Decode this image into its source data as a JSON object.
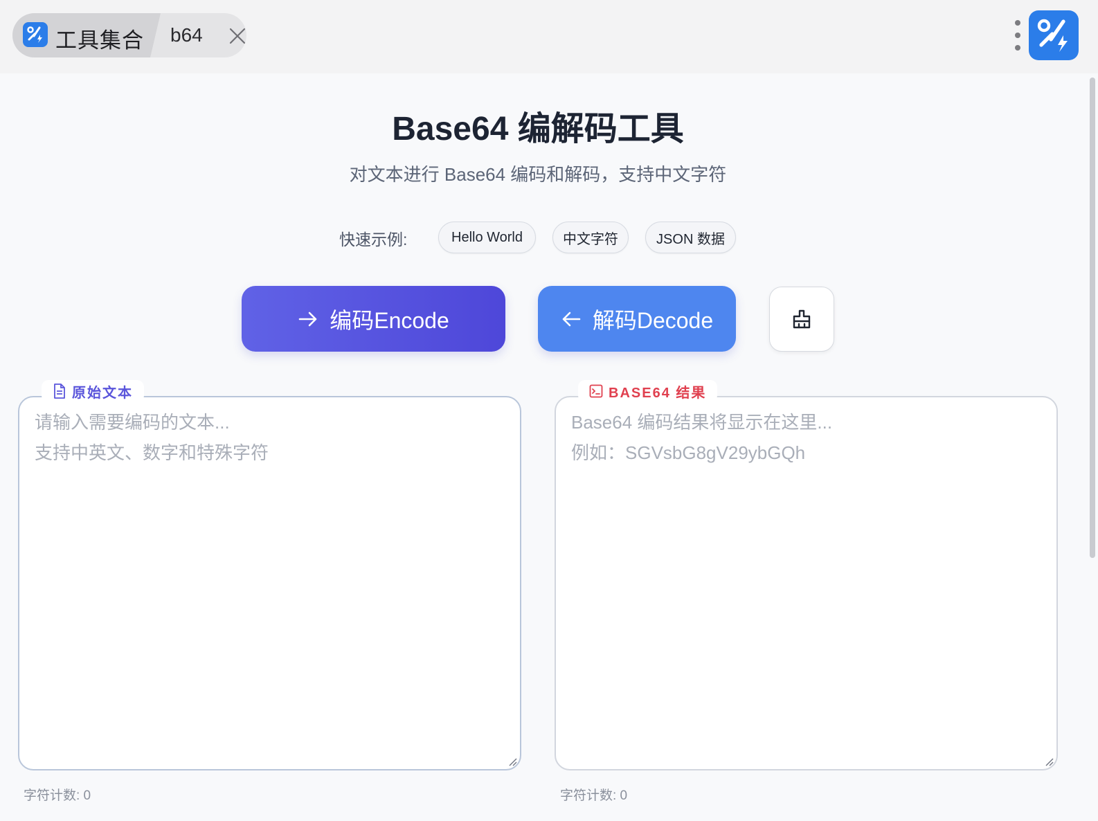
{
  "tabs": {
    "app_name": "工具集合",
    "current": "b64"
  },
  "header": {
    "title": "Base64 编解码工具",
    "subtitle": "对文本进行 Base64 编码和解码，支持中文字符"
  },
  "examples": {
    "label": "快速示例:",
    "items": [
      "Hello World",
      "中文字符",
      "JSON 数据"
    ]
  },
  "actions": {
    "encode_label": "编码Encode",
    "decode_label": "解码Decode"
  },
  "input_panel": {
    "tag": "原始文本",
    "placeholder": "请输入需要编码的文本...\n支持中英文、数字和特殊字符",
    "counter": "字符计数: 0"
  },
  "output_panel": {
    "tag": "BASE64 结果",
    "placeholder": "Base64 编码结果将显示在这里...\n例如：SGVsbG8gV29ybGQh",
    "counter": "字符计数: 0"
  },
  "colors": {
    "accent_encode": "#5a55db",
    "accent_decode": "#4e86ef",
    "accent_result": "#e0404f"
  }
}
